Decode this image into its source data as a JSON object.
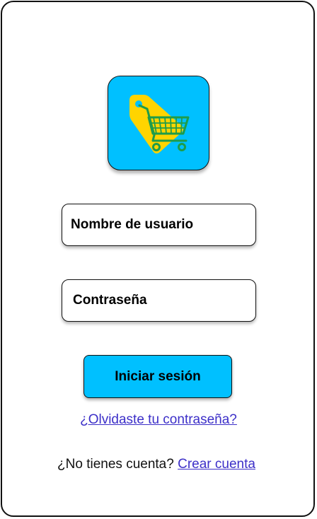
{
  "app": {
    "logo_icon": "shopping-cart-tag-icon",
    "accent_color": "#00c0ff",
    "link_color": "#3c2fc8"
  },
  "form": {
    "username_label": "Nombre de usuario",
    "password_label": "Contraseña",
    "login_button": "Iniciar sesión",
    "forgot_link": "¿Olvidaste tu contraseña?"
  },
  "signup": {
    "prompt": "¿No tienes cuenta?",
    "link": "Crear cuenta"
  }
}
